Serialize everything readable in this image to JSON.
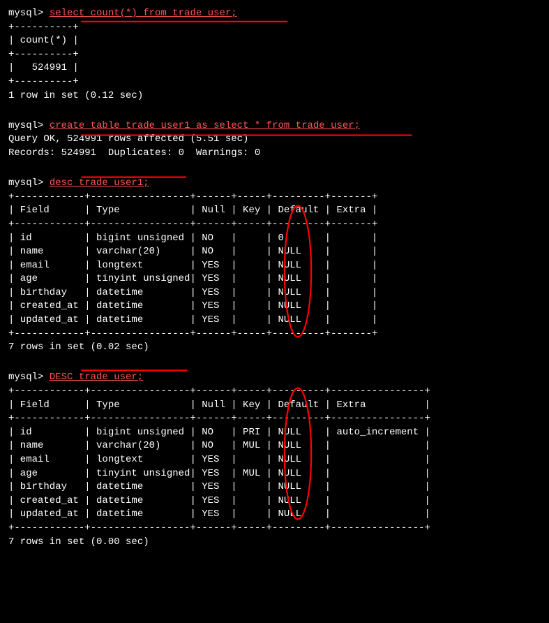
{
  "terminal": {
    "bg": "#000000",
    "fg": "#ffffff",
    "prompt": "mysql>",
    "blocks": [
      {
        "id": "block1",
        "command": "select count(*) from trade_user;",
        "output": [
          "+----------+",
          "| count(*) |",
          "+----------+",
          "|   524991 |",
          "+----------+",
          "1 row in set (0.12 sec)"
        ]
      },
      {
        "id": "block2",
        "command": "create table trade_user1 as select * from trade_user;",
        "output": [
          "Query OK, 524991 rows affected (5.51 sec)",
          "Records: 524991  Duplicates: 0  Warnings: 0"
        ]
      },
      {
        "id": "block3",
        "command": "desc trade_user1;",
        "output": [
          "+------------+-----------------+------+-----+---------+-------+",
          "| Field      | Type            | Null | Key | Default | Extra |",
          "+------------+-----------------+------+-----+---------+-------+",
          "| id         | bigint unsigned | NO   |     | 0       |       |",
          "| name       | varchar(20)     | NO   |     | NULL    |       |",
          "| email      | longtext        | YES  |     | NULL    |       |",
          "| age        | tinyint unsigned| YES  |     | NULL    |       |",
          "| birthday   | datetime        | YES  |     | NULL    |       |",
          "| created_at | datetime        | YES  |     | NULL    |       |",
          "| updated_at | datetime        | YES  |     | NULL    |       |",
          "+------------+-----------------+------+-----+---------+-------+",
          "7 rows in set (0.02 sec)"
        ]
      },
      {
        "id": "block4",
        "command": "DESC trade_user;",
        "output": [
          "+------------+-----------------+------+-----+---------+----------------+",
          "| Field      | Type            | Null | Key | Default | Extra          |",
          "+------------+-----------------+------+-----+---------+----------------+",
          "| id         | bigint unsigned | NO   | PRI | NULL    | auto_increment |",
          "| name       | varchar(20)     | NO   | MUL | NULL    |                |",
          "| email      | longtext        | YES  |     | NULL    |                |",
          "| age        | tinyint unsigned| YES  | MUL | NULL    |                |",
          "| birthday   | datetime        | YES  |     | NULL    |                |",
          "| created_at | datetime        | YES  |     | NULL    |                |",
          "| updated_at | datetime        | YES  |     | NULL    |                |",
          "+------------+-----------------+------+-----+---------+----------------+",
          "7 rows in set (0.00 sec)"
        ]
      }
    ]
  }
}
